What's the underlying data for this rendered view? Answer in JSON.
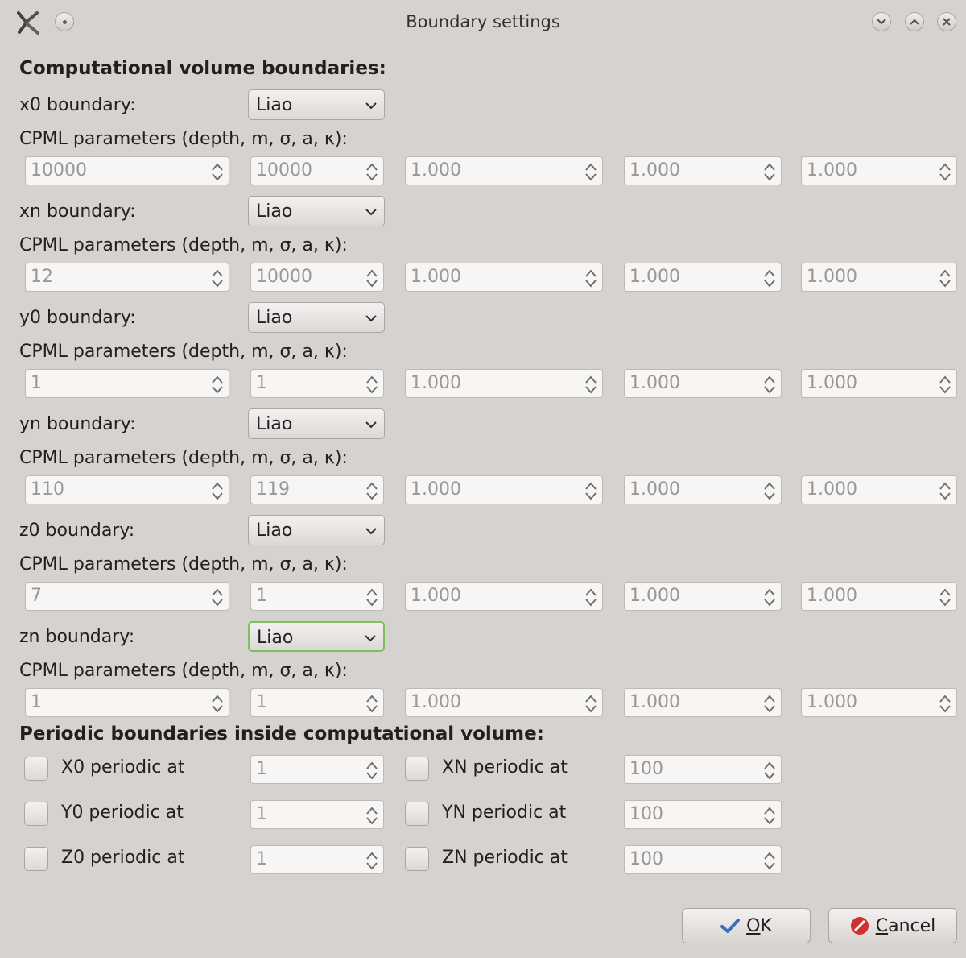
{
  "window": {
    "title": "Boundary settings"
  },
  "sections": {
    "computational": "Computational volume boundaries:",
    "periodic": "Periodic boundaries inside computational volume:"
  },
  "cpml_label": "CPML parameters (depth, m, σ, a, κ):",
  "boundaries": [
    {
      "label": "x0 boundary:",
      "type": "Liao",
      "params": [
        "10000",
        "10000",
        "1.000",
        "1.000",
        "1.000"
      ]
    },
    {
      "label": "xn boundary:",
      "type": "Liao",
      "params": [
        "12",
        "10000",
        "1.000",
        "1.000",
        "1.000"
      ]
    },
    {
      "label": "y0 boundary:",
      "type": "Liao",
      "params": [
        "1",
        "1",
        "1.000",
        "1.000",
        "1.000"
      ]
    },
    {
      "label": "yn boundary:",
      "type": "Liao",
      "params": [
        "110",
        "119",
        "1.000",
        "1.000",
        "1.000"
      ]
    },
    {
      "label": "z0 boundary:",
      "type": "Liao",
      "params": [
        "7",
        "1",
        "1.000",
        "1.000",
        "1.000"
      ]
    },
    {
      "label": "zn boundary:",
      "type": "Liao",
      "params": [
        "1",
        "1",
        "1.000",
        "1.000",
        "1.000"
      ]
    }
  ],
  "periodic": [
    {
      "left_label": "X0 periodic at",
      "left_value": "1",
      "right_label": "XN periodic at",
      "right_value": "100"
    },
    {
      "left_label": "Y0 periodic at",
      "left_value": "1",
      "right_label": "YN periodic at",
      "right_value": "100"
    },
    {
      "left_label": "Z0 periodic at",
      "left_value": "1",
      "right_label": "ZN periodic at",
      "right_value": "100"
    }
  ],
  "buttons": {
    "ok_mnemonic": "O",
    "ok_rest": "K",
    "cancel_mnemonic": "C",
    "cancel_rest": "ancel"
  },
  "colors": {
    "background": "#d6d2d0",
    "focus_border": "#7fbf60",
    "cancel_icon": "#d03030",
    "ok_icon": "#3a6fb0"
  },
  "icons": {
    "app": "x-tool-icon",
    "menu": "window-menu-icon",
    "minimize": "minimize-icon",
    "maximize": "maximize-icon",
    "close": "close-icon"
  }
}
